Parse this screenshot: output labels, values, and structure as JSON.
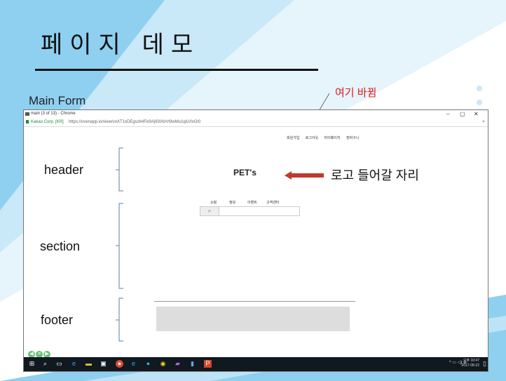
{
  "slide": {
    "title": "페이지 데모",
    "main_form_label": "Main Form",
    "annotation": "여기 바뀜",
    "logo_note": "로고 들어갈 자리",
    "labels": {
      "header": "header",
      "section": "section",
      "footer": "footer"
    }
  },
  "browser": {
    "tab_title": "main (3 of 13) - Chrome",
    "secure_label": "Kakao Corp. [KR]",
    "url": "https://ovenapp.io/view/voXT1xDEgszb4Fe9Aj93lXbVt9wMu1qiU/IxGl0",
    "window_controls": {
      "minimize": "–",
      "maximize": "▢",
      "close": "✕"
    }
  },
  "page": {
    "top_nav": [
      "회원가입",
      "로그아웃",
      "마이페이지",
      "장바구니"
    ],
    "logo": "PET's",
    "menu": [
      "쇼핑",
      "정보",
      "이벤트",
      "고객센터"
    ],
    "search_icon_glyph": "⌕",
    "search_placeholder": ""
  },
  "taskbar": {
    "time": "오후 10:47",
    "date": "2017-08-22"
  },
  "colors": {
    "annotation": "#e01a1a",
    "arrow": "#c0392b",
    "bg_blue": "#8ecfee"
  }
}
